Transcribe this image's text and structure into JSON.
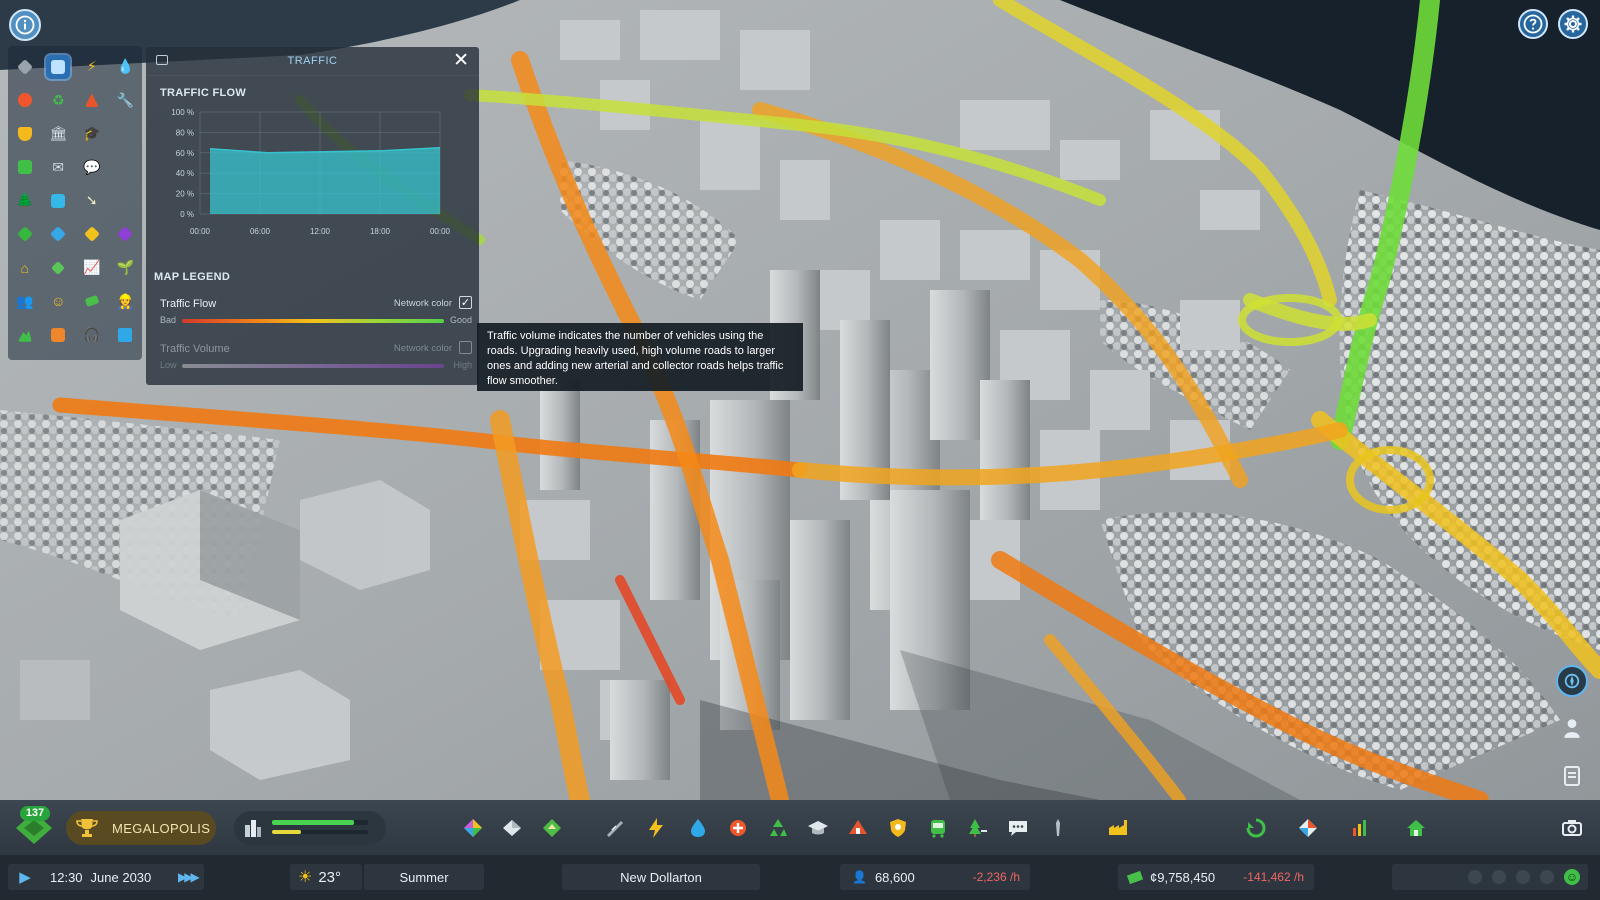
{
  "traffic_panel": {
    "title": "TRAFFIC",
    "flow_section": "TRAFFIC FLOW",
    "legend_section": "MAP LEGEND",
    "legend": [
      {
        "name": "Traffic Flow",
        "network_color_label": "Network color",
        "checked": true,
        "low": "Bad",
        "high": "Good"
      },
      {
        "name": "Traffic Volume",
        "network_color_label": "Network color",
        "checked": false,
        "low": "Low",
        "high": "High"
      }
    ]
  },
  "chart_data": {
    "type": "area",
    "x": [
      "00:00",
      "06:00",
      "12:00",
      "18:00",
      "00:00"
    ],
    "values": [
      64,
      60,
      61,
      62,
      65
    ],
    "yticks": [
      "100 %",
      "80 %",
      "60 %",
      "40 %",
      "20 %",
      "0 %"
    ],
    "ylim": [
      0,
      100
    ],
    "grid": true,
    "fill_color": "#35c4cf"
  },
  "tooltip": {
    "text": "Traffic volume indicates the number of vehicles using the roads. Upgrading heavily used, high volume roads to larger ones and adding new arterial and collector roads helps traffic flow smoother."
  },
  "milestone": {
    "count": "137",
    "name": "MEGALOPOLIS"
  },
  "progress": {
    "green_fraction": 0.85,
    "yellow_fraction": 0.3
  },
  "status_bar": {
    "time": "12:30",
    "date": "June 2030",
    "temperature": "23°",
    "season": "Summer",
    "city_name": "New Dollarton",
    "population": "68,600",
    "population_change": "-2,236 /h",
    "money": "¢9,758,450",
    "money_change": "-141,462 /h"
  },
  "colors": {
    "bad": "#d23a2a",
    "good": "#56d04a",
    "low": "#e0e0e0",
    "high": "#9b3fd6",
    "accent": "#2a6fb1"
  },
  "icons": {
    "top_left": "info-icon",
    "top_right": [
      "help-icon",
      "gear-icon"
    ],
    "right_side": [
      "compass-icon",
      "citizen-icon",
      "notes-icon"
    ],
    "toolbar": [
      "zoning-icon",
      "area-icon",
      "landscaping-icon",
      "road-icon",
      "electricity-icon",
      "water-icon",
      "health-icon",
      "recycle-icon",
      "education-icon",
      "fire-icon",
      "police-icon",
      "transport-icon",
      "parks-icon",
      "communication-icon",
      "landmark-icon",
      "industry-icon",
      "area-tool-icon",
      "map-icon",
      "statistics-icon",
      "home-icon",
      "camera-icon"
    ]
  }
}
